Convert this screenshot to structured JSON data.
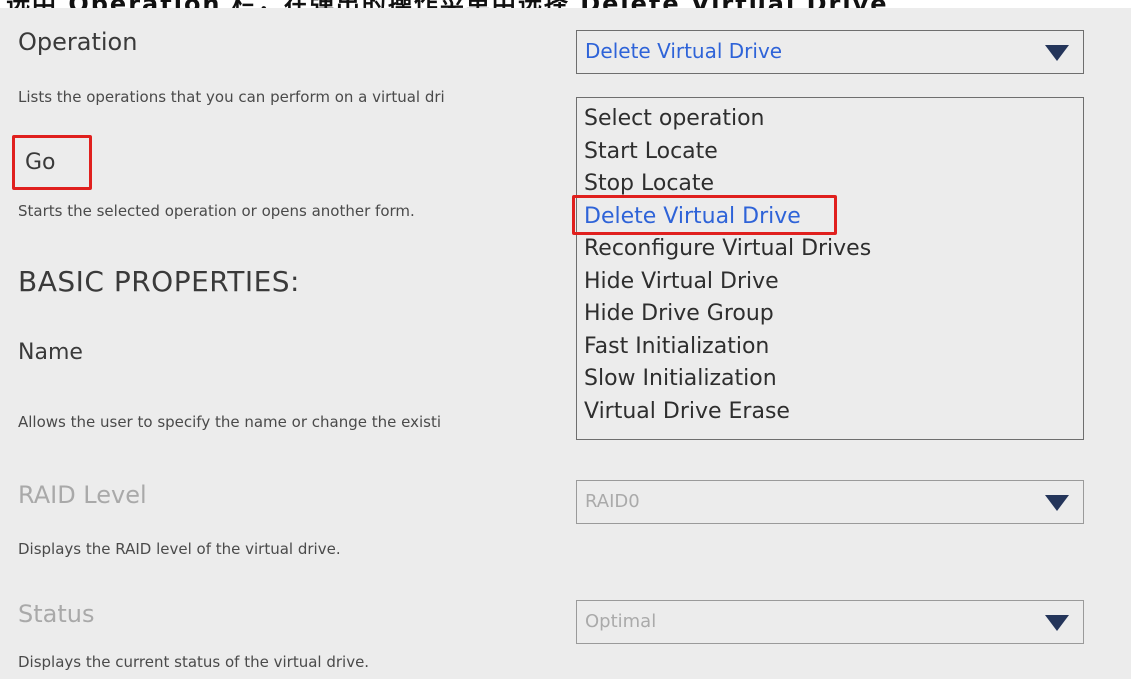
{
  "header_caption": "选中 Operation 栏，在弹出的操作菜单中选择 Delete Virtual Drive",
  "operation": {
    "label": "Operation",
    "description": "Lists the operations that you can perform on a virtual dri",
    "selected_value": "Delete Virtual Drive",
    "options": [
      "Select operation",
      "Start Locate",
      "Stop Locate",
      "Delete Virtual Drive",
      "Reconfigure Virtual Drives",
      "Hide Virtual Drive",
      "Hide Drive Group",
      "Fast Initialization",
      "Slow Initialization",
      "Virtual Drive Erase"
    ],
    "selected_index": 3
  },
  "go": {
    "label": "Go",
    "description": "Starts the selected operation or opens another form."
  },
  "basic_properties": {
    "heading": "BASIC PROPERTIES:"
  },
  "name": {
    "label": "Name",
    "description": "Allows the user to specify the name or change the existi"
  },
  "raid_level": {
    "label": "RAID Level",
    "value": "RAID0",
    "description": "Displays the RAID level of the virtual drive."
  },
  "status": {
    "label": "Status",
    "value": "Optimal",
    "description": "Displays the current status of the virtual drive."
  },
  "colors": {
    "highlight_box": "#e0201e",
    "selected_text": "#2e63d8",
    "dropdown_arrow": "#24355a",
    "background": "#ececec"
  },
  "icons": {
    "dropdown_arrow": "triangle-down-icon"
  }
}
